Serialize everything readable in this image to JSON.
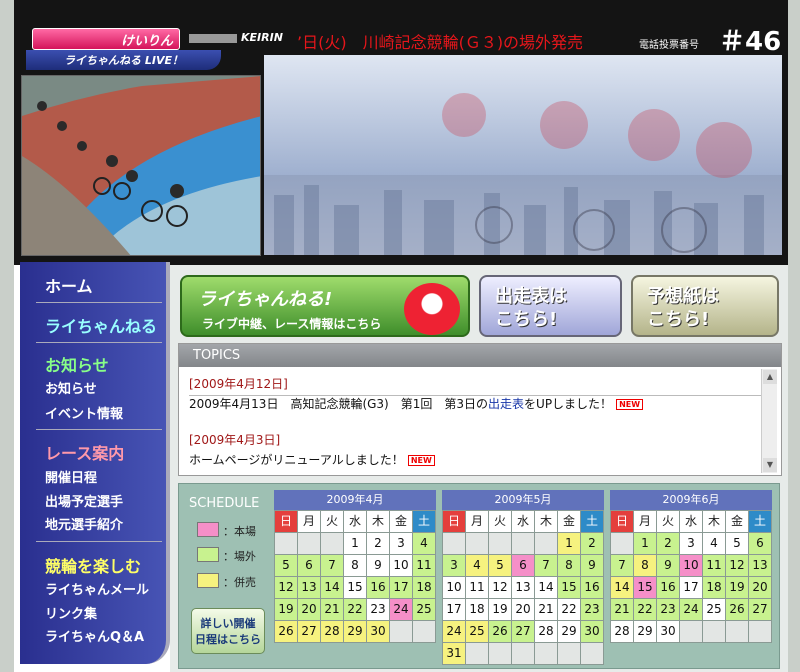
{
  "colors": {
    "header_bg": "#141414",
    "marquee": "#e5161b",
    "nav_bg": "#2a2f8f",
    "calendar_header": "#6172bb",
    "sunday": "#e43f3c",
    "saturday": "#2e8bc8",
    "legend_home": "#f58fc8",
    "legend_outside": "#c8f28f",
    "legend_joint": "#f6f27f"
  },
  "header": {
    "logo_text": "けいりん",
    "live_label": "ライちゃんねる LIVE！",
    "keirin_label": "KEIRIN",
    "marquee": "’日(火)　川崎記念競輪(Ｇ３)の場外発売",
    "tel_label": "電話投票番号",
    "tel_number": "＃46"
  },
  "nav": {
    "home": "ホーム",
    "live": "ライちゃんねる",
    "notice_heading": "お知らせ",
    "notice": "お知らせ",
    "event": "イベント情報",
    "race_heading": "レース案内",
    "schedule": "開催日程",
    "riders": "出場予定選手",
    "local_riders": "地元選手紹介",
    "enjoy_heading": "競輪を楽しむ",
    "mail": "ライちゃんメール",
    "links": "リンク集",
    "qa": "ライちゃんQ＆A"
  },
  "banners": {
    "live_title": "ライちゃんねる!",
    "live_sub": "ライブ中継、レース情報はこちら",
    "entry_line1": "出走表は",
    "entry_line2": "こちら!",
    "pred_line1": "予想紙は",
    "pred_line2": "こちら!"
  },
  "topics": {
    "title": "TOPICS",
    "items": [
      {
        "date": "[2009年4月12日]",
        "text_before": "2009年4月13日　高知記念競輪(G3)　第1回　第3日の",
        "link": "出走表",
        "text_after": "をUPしました！",
        "new_badge": "NEW"
      },
      {
        "date": "[2009年4月3日]",
        "text_before": "ホームページがリニューアルしました！",
        "link": "",
        "text_after": "",
        "new_badge": "NEW"
      }
    ]
  },
  "schedule": {
    "label": "SCHEDULE",
    "legend": [
      {
        "color": "#f58fc8",
        "label": "：本場"
      },
      {
        "color": "#c8f28f",
        "label": "：場外"
      },
      {
        "color": "#f6f27f",
        "label": "：併売"
      }
    ],
    "detail_line1": "詳しい開催",
    "detail_line2": "日程はこちら",
    "weekdays": [
      "日",
      "月",
      "火",
      "水",
      "木",
      "金",
      "土"
    ],
    "months": [
      {
        "title": "2009年4月",
        "cells": [
          [
            "",
            ""
          ],
          [
            "",
            ""
          ],
          [
            "",
            ""
          ],
          [
            "1",
            "w"
          ],
          [
            "2",
            "w"
          ],
          [
            "3",
            "w"
          ],
          [
            "4",
            "g"
          ],
          [
            "5",
            "g"
          ],
          [
            "6",
            "g"
          ],
          [
            "7",
            "g"
          ],
          [
            "8",
            "w"
          ],
          [
            "9",
            "w"
          ],
          [
            "10",
            "w"
          ],
          [
            "11",
            "g"
          ],
          [
            "12",
            "g"
          ],
          [
            "13",
            "g"
          ],
          [
            "14",
            "g"
          ],
          [
            "15",
            "w"
          ],
          [
            "16",
            "g"
          ],
          [
            "17",
            "g"
          ],
          [
            "18",
            "g"
          ],
          [
            "19",
            "g"
          ],
          [
            "20",
            "g"
          ],
          [
            "21",
            "g"
          ],
          [
            "22",
            "g"
          ],
          [
            "23",
            "w"
          ],
          [
            "24",
            "p"
          ],
          [
            "25",
            "g"
          ],
          [
            "26",
            "y"
          ],
          [
            "27",
            "y"
          ],
          [
            "28",
            "y"
          ],
          [
            "29",
            "y"
          ],
          [
            "30",
            "y"
          ],
          [
            "",
            ""
          ],
          [
            "",
            ""
          ]
        ]
      },
      {
        "title": "2009年5月",
        "cells": [
          [
            "",
            ""
          ],
          [
            "",
            ""
          ],
          [
            "",
            ""
          ],
          [
            "",
            ""
          ],
          [
            "",
            ""
          ],
          [
            "1",
            "y"
          ],
          [
            "2",
            "g"
          ],
          [
            "3",
            "g"
          ],
          [
            "4",
            "y"
          ],
          [
            "5",
            "y"
          ],
          [
            "6",
            "p"
          ],
          [
            "7",
            "g"
          ],
          [
            "8",
            "g"
          ],
          [
            "9",
            "g"
          ],
          [
            "10",
            "w"
          ],
          [
            "11",
            "w"
          ],
          [
            "12",
            "w"
          ],
          [
            "13",
            "w"
          ],
          [
            "14",
            "w"
          ],
          [
            "15",
            "g"
          ],
          [
            "16",
            "g"
          ],
          [
            "17",
            "w"
          ],
          [
            "18",
            "w"
          ],
          [
            "19",
            "w"
          ],
          [
            "20",
            "w"
          ],
          [
            "21",
            "w"
          ],
          [
            "22",
            "w"
          ],
          [
            "23",
            "g"
          ],
          [
            "24",
            "y"
          ],
          [
            "25",
            "y"
          ],
          [
            "26",
            "g"
          ],
          [
            "27",
            "g"
          ],
          [
            "28",
            "w"
          ],
          [
            "29",
            "w"
          ],
          [
            "30",
            "g"
          ],
          [
            "31",
            "y"
          ],
          [
            "",
            ""
          ],
          [
            "",
            ""
          ],
          [
            "",
            ""
          ],
          [
            "",
            ""
          ],
          [
            "",
            ""
          ],
          [
            "",
            ""
          ]
        ]
      },
      {
        "title": "2009年6月",
        "cells": [
          [
            "",
            ""
          ],
          [
            "1",
            "g"
          ],
          [
            "2",
            "g"
          ],
          [
            "3",
            "w"
          ],
          [
            "4",
            "w"
          ],
          [
            "5",
            "w"
          ],
          [
            "6",
            "g"
          ],
          [
            "7",
            "g"
          ],
          [
            "8",
            "y"
          ],
          [
            "9",
            "g"
          ],
          [
            "10",
            "p"
          ],
          [
            "11",
            "g"
          ],
          [
            "12",
            "g"
          ],
          [
            "13",
            "g"
          ],
          [
            "14",
            "y"
          ],
          [
            "15",
            "p"
          ],
          [
            "16",
            "g"
          ],
          [
            "17",
            "w"
          ],
          [
            "18",
            "g"
          ],
          [
            "19",
            "g"
          ],
          [
            "20",
            "g"
          ],
          [
            "21",
            "g"
          ],
          [
            "22",
            "g"
          ],
          [
            "23",
            "g"
          ],
          [
            "24",
            "g"
          ],
          [
            "25",
            "w"
          ],
          [
            "26",
            "g"
          ],
          [
            "27",
            "g"
          ],
          [
            "28",
            "w"
          ],
          [
            "29",
            "w"
          ],
          [
            "30",
            "w"
          ],
          [
            "",
            ""
          ],
          [
            "",
            ""
          ],
          [
            "",
            ""
          ],
          [
            "",
            ""
          ]
        ]
      }
    ]
  }
}
